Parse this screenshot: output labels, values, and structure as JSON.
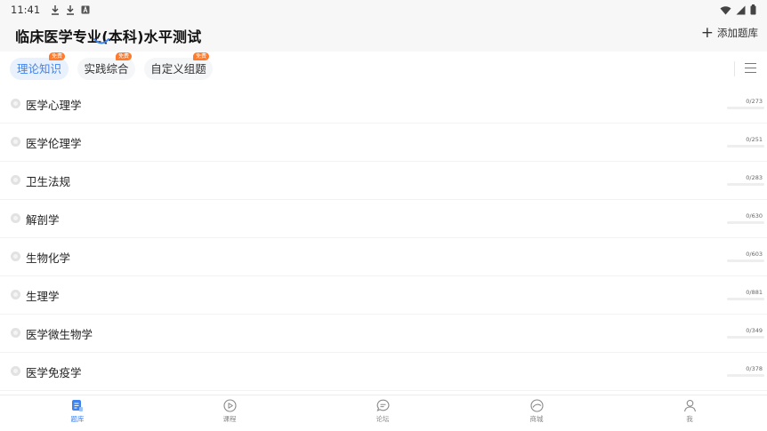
{
  "status_bar": {
    "time": "11:41",
    "icons": [
      "download-icon",
      "download-icon",
      "font-icon",
      "wifi-icon",
      "signal-icon",
      "battery-icon"
    ]
  },
  "header": {
    "title": "临床医学专业(本科)水平测试",
    "add_label": "添加题库"
  },
  "tabs": [
    {
      "label": "理论知识",
      "badge": "免费",
      "active": true
    },
    {
      "label": "实践综合",
      "badge": "免费",
      "active": false
    },
    {
      "label": "自定义组题",
      "badge": "免费",
      "active": false
    }
  ],
  "subjects": [
    {
      "name": "医学心理学",
      "progress": "0/273"
    },
    {
      "name": "医学伦理学",
      "progress": "0/251"
    },
    {
      "name": "卫生法规",
      "progress": "0/283"
    },
    {
      "name": "解剖学",
      "progress": "0/630"
    },
    {
      "name": "生物化学",
      "progress": "0/603"
    },
    {
      "name": "生理学",
      "progress": "0/881"
    },
    {
      "name": "医学微生物学",
      "progress": "0/349"
    },
    {
      "name": "医学免疫学",
      "progress": "0/378"
    }
  ],
  "bottom_nav": [
    {
      "label": "题库",
      "icon": "question-bank-icon",
      "active": true
    },
    {
      "label": "课程",
      "icon": "play-circle-icon",
      "active": false
    },
    {
      "label": "论坛",
      "icon": "chat-bubble-icon",
      "active": false
    },
    {
      "label": "商城",
      "icon": "shop-icon",
      "active": false
    },
    {
      "label": "我",
      "icon": "user-icon",
      "active": false
    }
  ],
  "colors": {
    "accent": "#3d84f0",
    "badge": "#ff7a2a",
    "header_bg": "#f7f7f7"
  }
}
